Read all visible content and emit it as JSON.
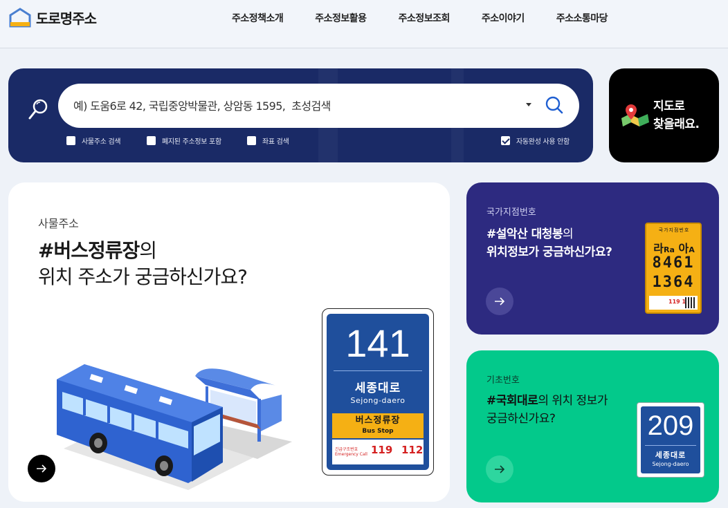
{
  "header": {
    "logo_text": "도로명주소",
    "nav": [
      "주소정책소개",
      "주소정보활용",
      "주소정보조회",
      "주소이야기",
      "주소소통마당"
    ]
  },
  "search": {
    "placeholder": "예) 도움6로 42, 국립중앙박물관, 상암동 1595,  초성검색",
    "options": [
      {
        "label": "사물주소 검색",
        "checked": false
      },
      {
        "label": "폐지된 주소정보 포함",
        "checked": false
      },
      {
        "label": "좌표 검색",
        "checked": false
      }
    ],
    "autocomplete": {
      "label": "자동완성 사용 안함",
      "checked": true
    }
  },
  "map_card": {
    "line1": "지도로",
    "line2": "찾을래요."
  },
  "big_card": {
    "category": "사물주소",
    "title_strong": "#버스정류장",
    "title_suffix": "의",
    "title_line2": "위치 주소가 궁금하신가요?",
    "sign": {
      "number": "141",
      "name_ko": "세종대로",
      "name_en": "Sejong-daero",
      "stop_ko": "버스정류장",
      "stop_en": "Bus Stop",
      "emergency_label_ko": "긴급구조번호",
      "emergency_label_en": "Emergency Call",
      "emergency_num1": "119",
      "emergency_num2": "112"
    }
  },
  "purple_card": {
    "category": "국가지점번호",
    "title_strong": "#설악산 대청봉",
    "title_suffix": "의",
    "title_line2": "위치정보가 궁금하신가요?",
    "sign": {
      "header": "국가지점번호",
      "ra": "라",
      "ra_en": "Ra",
      "a": "아",
      "a_en": "A",
      "row1": "8461",
      "row2": "1364",
      "emergency": "119 112"
    }
  },
  "green_card": {
    "category": "기초번호",
    "title_strong": "#국회대로",
    "title_suffix": "의 위치 정보가",
    "title_line2": "궁금하신가요?",
    "sign": {
      "number": "209",
      "name_ko": "세종대로",
      "name_en": "Sejong-daero"
    }
  },
  "colors": {
    "navy": "#1a2a66",
    "purple": "#2d2a80",
    "green": "#03c98b",
    "sign_blue": "#1f4f9c",
    "sign_yellow": "#f5b014"
  }
}
